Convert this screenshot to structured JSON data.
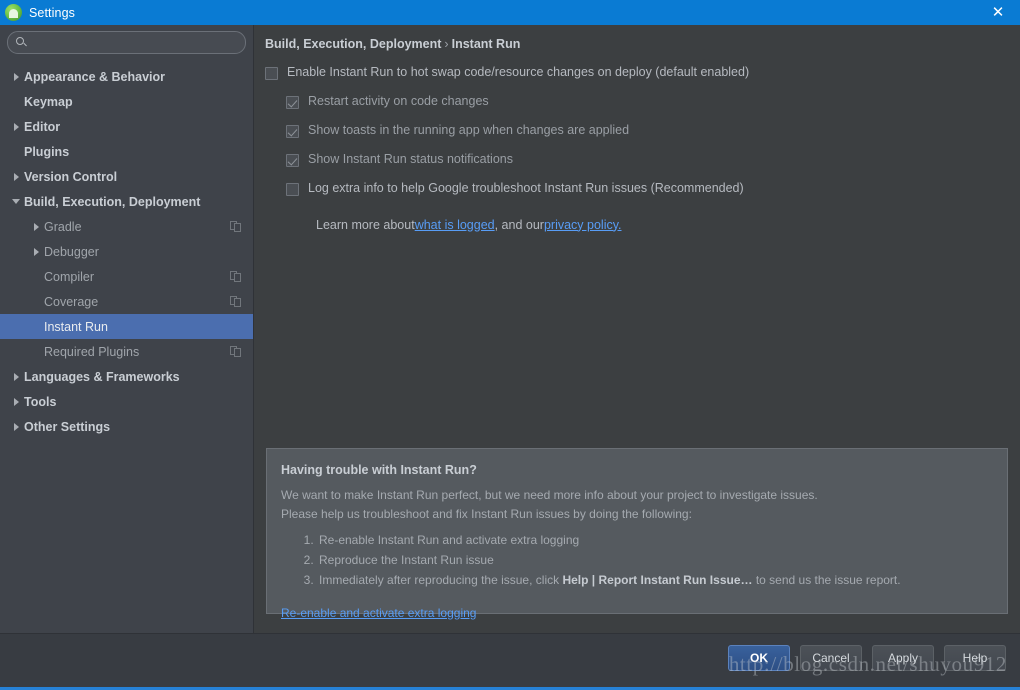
{
  "window": {
    "title": "Settings",
    "app_icon": "android-studio-icon",
    "close_icon": "close-icon",
    "accent_color": "#0a7bd3"
  },
  "search": {
    "placeholder": "",
    "value": "",
    "icon": "search-icon"
  },
  "sidebar": {
    "items": [
      {
        "label": "Appearance & Behavior",
        "level": 0,
        "arrow": "right",
        "selected": false,
        "module_icon": false
      },
      {
        "label": "Keymap",
        "level": 0,
        "arrow": "none",
        "selected": false,
        "module_icon": false
      },
      {
        "label": "Editor",
        "level": 0,
        "arrow": "right",
        "selected": false,
        "module_icon": false
      },
      {
        "label": "Plugins",
        "level": 0,
        "arrow": "none",
        "selected": false,
        "module_icon": false
      },
      {
        "label": "Version Control",
        "level": 0,
        "arrow": "right",
        "selected": false,
        "module_icon": false
      },
      {
        "label": "Build, Execution, Deployment",
        "level": 0,
        "arrow": "down",
        "selected": false,
        "module_icon": false
      },
      {
        "label": "Gradle",
        "level": 1,
        "arrow": "right",
        "selected": false,
        "module_icon": true
      },
      {
        "label": "Debugger",
        "level": 1,
        "arrow": "right",
        "selected": false,
        "module_icon": false
      },
      {
        "label": "Compiler",
        "level": 1,
        "arrow": "none",
        "selected": false,
        "module_icon": true
      },
      {
        "label": "Coverage",
        "level": 1,
        "arrow": "none",
        "selected": false,
        "module_icon": true
      },
      {
        "label": "Instant Run",
        "level": 1,
        "arrow": "none",
        "selected": true,
        "module_icon": false
      },
      {
        "label": "Required Plugins",
        "level": 1,
        "arrow": "none",
        "selected": false,
        "module_icon": true
      },
      {
        "label": "Languages & Frameworks",
        "level": 0,
        "arrow": "right",
        "selected": false,
        "module_icon": false
      },
      {
        "label": "Tools",
        "level": 0,
        "arrow": "right",
        "selected": false,
        "module_icon": false
      },
      {
        "label": "Other Settings",
        "level": 0,
        "arrow": "right",
        "selected": false,
        "module_icon": false
      }
    ]
  },
  "content": {
    "breadcrumb": {
      "parent": "Build, Execution, Deployment",
      "separator": "›",
      "current": "Instant Run"
    },
    "options": [
      {
        "label": "Enable Instant Run to hot swap code/resource changes on deploy (default enabled)",
        "checked": false,
        "indent": false,
        "disabled": false
      },
      {
        "label": "Restart activity on code changes",
        "checked": true,
        "indent": true,
        "disabled": true
      },
      {
        "label": "Show toasts in the running app when changes are applied",
        "checked": true,
        "indent": true,
        "disabled": true
      },
      {
        "label": "Show Instant Run status notifications",
        "checked": true,
        "indent": true,
        "disabled": true
      },
      {
        "label": "Log extra info to help Google troubleshoot Instant Run issues (Recommended)",
        "checked": false,
        "indent": true,
        "disabled": false
      }
    ],
    "learn_more": {
      "prefix": "Learn more about ",
      "link1": "what is logged",
      "middle": ", and our ",
      "link2": "privacy policy.",
      "link_color": "#589df6"
    },
    "trouble_panel": {
      "heading": "Having trouble with Instant Run?",
      "paragraph_line1": "We want to make Instant Run perfect, but we need more info about your project to investigate issues.",
      "paragraph_line2": "Please help us troubleshoot and fix Instant Run issues by doing the following:",
      "steps": [
        {
          "text_before": "Re-enable Instant Run and activate extra logging",
          "bold": "",
          "text_after": ""
        },
        {
          "text_before": "Reproduce the Instant Run issue",
          "bold": "",
          "text_after": ""
        },
        {
          "text_before": "Immediately after reproducing the issue, click ",
          "bold": "Help | Report Instant Run Issue…",
          "text_after": " to send us the issue report."
        }
      ],
      "bottom_link": "Re-enable and activate extra logging"
    }
  },
  "footer": {
    "buttons": [
      {
        "label": "OK",
        "primary": true
      },
      {
        "label": "Cancel",
        "primary": false
      },
      {
        "label": "Apply",
        "primary": false
      },
      {
        "label": "Help",
        "primary": false
      }
    ]
  },
  "watermark": {
    "text": "http://blog.csdn.net/shuyou912"
  }
}
